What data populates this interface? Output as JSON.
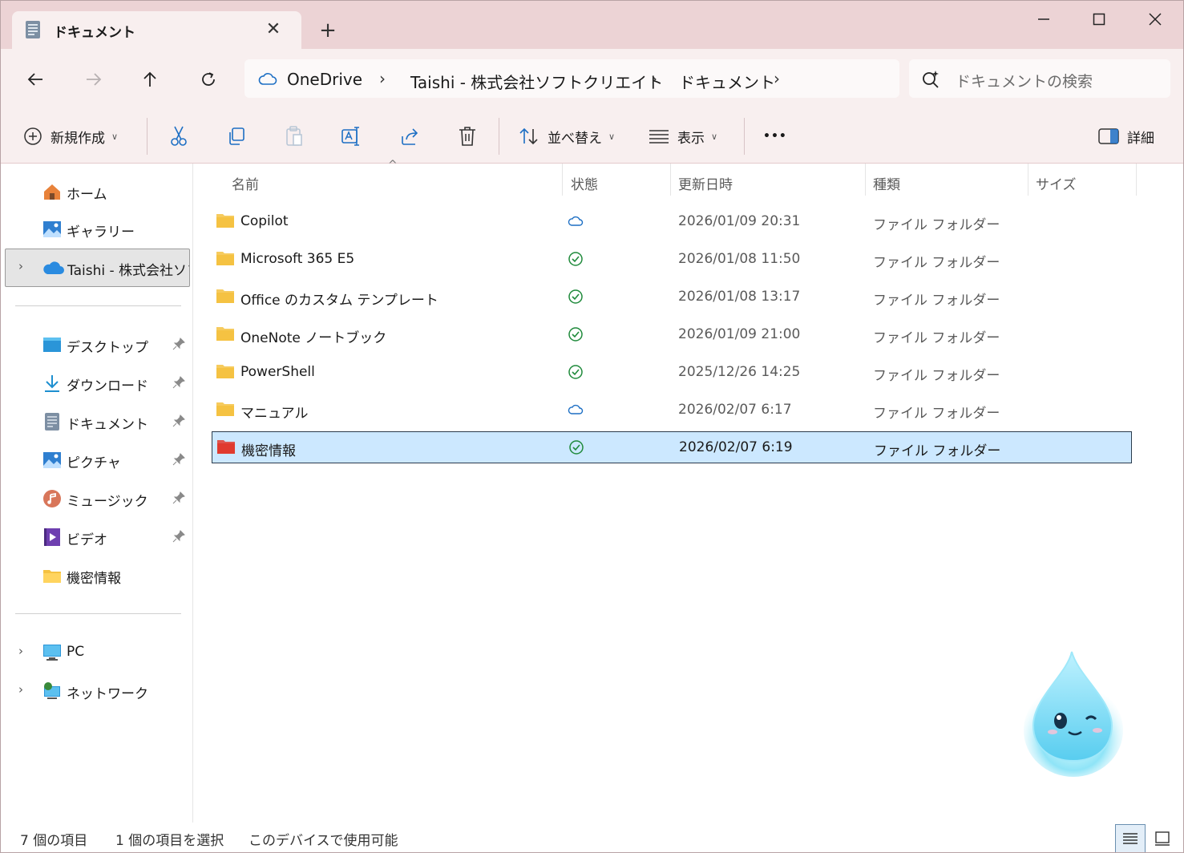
{
  "window": {
    "tab_title": "ドキュメント",
    "new_tab_symbol": "+"
  },
  "address": {
    "crumbs": [
      "OneDrive",
      "Taishi - 株式会社ソフトクリエイト",
      "ドキュメント"
    ],
    "search_placeholder": "ドキュメントの検索"
  },
  "toolbar": {
    "new_label": "新規作成",
    "sort_label": "並べ替え",
    "view_label": "表示",
    "more_label": "•••",
    "details_label": "詳細"
  },
  "nav": {
    "home": "ホーム",
    "gallery": "ギャラリー",
    "onedrive": "Taishi - 株式会社ソフ",
    "desktop": "デスクトップ",
    "downloads": "ダウンロード",
    "documents": "ドキュメント",
    "pictures": "ピクチャ",
    "music": "ミュージック",
    "videos": "ビデオ",
    "secret": "機密情報",
    "pc": "PC",
    "network": "ネットワーク"
  },
  "columns": {
    "name": "名前",
    "status": "状態",
    "modified": "更新日時",
    "type": "種類",
    "size": "サイズ"
  },
  "files": [
    {
      "name": "Copilot",
      "status": "cloud",
      "date": "2026/01/09 20:31",
      "type": "ファイル フォルダー",
      "color": "#f5c242"
    },
    {
      "name": "Microsoft 365 E5",
      "status": "synced",
      "date": "2026/01/08 11:50",
      "type": "ファイル フォルダー",
      "color": "#f5c242"
    },
    {
      "name": "Office のカスタム テンプレート",
      "status": "synced",
      "date": "2026/01/08 13:17",
      "type": "ファイル フォルダー",
      "color": "#f5c242"
    },
    {
      "name": "OneNote ノートブック",
      "status": "synced",
      "date": "2026/01/09 21:00",
      "type": "ファイル フォルダー",
      "color": "#f5c242"
    },
    {
      "name": "PowerShell",
      "status": "synced",
      "date": "2025/12/26 14:25",
      "type": "ファイル フォルダー",
      "color": "#f5c242"
    },
    {
      "name": "マニュアル",
      "status": "cloud",
      "date": "2026/02/07 6:17",
      "type": "ファイル フォルダー",
      "color": "#f5c242"
    },
    {
      "name": "機密情報",
      "status": "synced",
      "date": "2026/02/07 6:19",
      "type": "ファイル フォルダー",
      "color": "#e03a2f"
    }
  ],
  "statusbar": {
    "count": "7 個の項目",
    "selected": "1 個の項目を選択",
    "availability": "このデバイスで使用可能"
  },
  "colors": {
    "accent": "#0067c0",
    "folder": "#f5c242",
    "folder_red": "#e03a2f",
    "synced_green": "#1f8a3b",
    "selection": "#cce8ff"
  }
}
